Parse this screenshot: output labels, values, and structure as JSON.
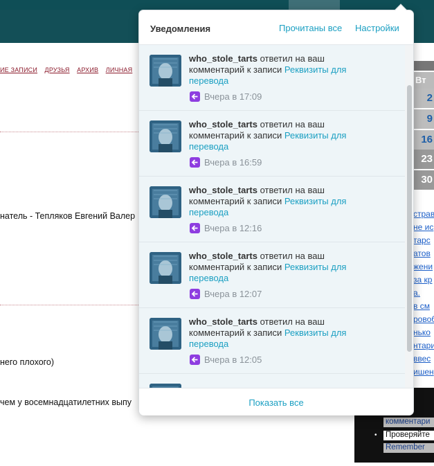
{
  "background": {
    "nav_links": [
      "ИЕ ЗАПИСИ",
      "ДРУЗЬЯ",
      "АРХИВ",
      "ЛИЧНАЯ"
    ],
    "text_lines": [
      "натель - Тепляков Евгений Валер",
      "него плохого)",
      "чем у восемнадцатилетних выпу"
    ],
    "calendar": {
      "weekday": "Вт",
      "days": [
        "2",
        "9",
        "16",
        "23",
        "30"
      ]
    },
    "right_links": [
      "страв",
      "не ис",
      "тарс",
      "атов",
      "жени",
      "за кр",
      "а.",
      "в см",
      "ровоб",
      "нько",
      "нтари",
      "ввес",
      "ишен"
    ],
    "bottom_rows": [
      "комментари",
      "Проверяйте",
      "Remember"
    ]
  },
  "popup": {
    "title": "Уведомления",
    "mark_all_read": "Прочитаны все",
    "settings": "Настройки",
    "show_all": "Показать все",
    "colors": {
      "accent": "#1a9fc2",
      "badge": "#8e3de0",
      "list_bg": "#eef5f8"
    },
    "items": [
      {
        "user": "who_stole_tarts",
        "action": " ответил на ваш комментарий к записи ",
        "post": "Реквизиты для перевода",
        "time": "Вчера в 17:09",
        "icon": "reply-arrow-icon"
      },
      {
        "user": "who_stole_tarts",
        "action": " ответил на ваш комментарий к записи ",
        "post": "Реквизиты для перевода",
        "time": "Вчера в 16:59",
        "icon": "reply-arrow-icon"
      },
      {
        "user": "who_stole_tarts",
        "action": " ответил на ваш комментарий к записи ",
        "post": "Реквизиты для перевода",
        "time": "Вчера в 12:16",
        "icon": "reply-arrow-icon"
      },
      {
        "user": "who_stole_tarts",
        "action": " ответил на ваш комментарий к записи ",
        "post": "Реквизиты для перевода",
        "time": "Вчера в 12:07",
        "icon": "reply-arrow-icon"
      },
      {
        "user": "who_stole_tarts",
        "action": " ответил на ваш комментарий к записи ",
        "post": "Реквизиты для перевода",
        "time": "Вчера в 12:05",
        "icon": "reply-arrow-icon"
      }
    ]
  }
}
